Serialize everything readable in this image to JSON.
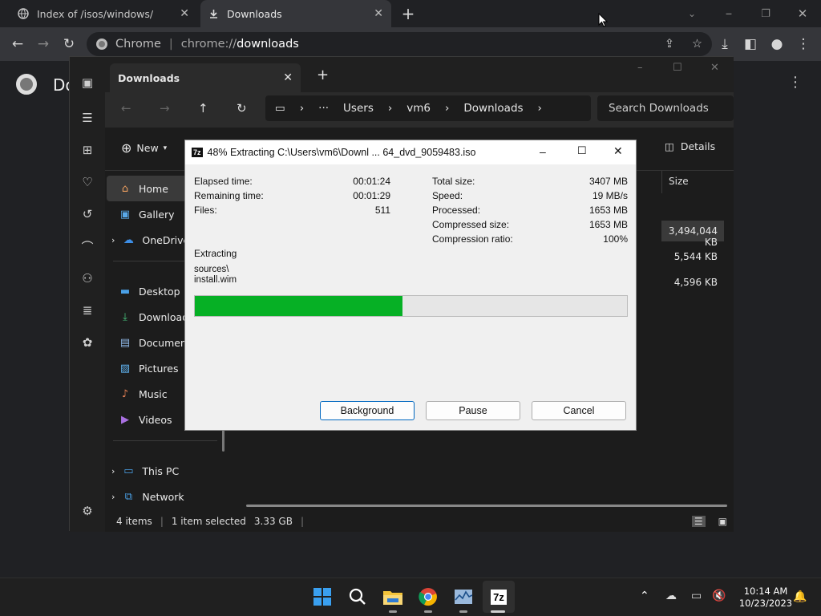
{
  "chrome": {
    "tabs": [
      {
        "title": "Index of /isos/windows/",
        "icon": "globe-icon"
      },
      {
        "title": "Downloads",
        "icon": "download-icon"
      }
    ],
    "omnibox": {
      "scheme_label": "Chrome",
      "url_prefix": "chrome://",
      "url_host": "downloads"
    },
    "page_title_partial": "Do"
  },
  "explorer": {
    "tab_title": "Downloads",
    "breadcrumb": [
      "Users",
      "vm6",
      "Downloads"
    ],
    "search_placeholder": "Search Downloads",
    "new_label": "New",
    "details_label": "Details",
    "column_size": "Size",
    "nav_items": [
      {
        "label": "Home",
        "icon": "home-icon"
      },
      {
        "label": "Gallery",
        "icon": "gallery-icon"
      },
      {
        "label": "OneDrive",
        "icon": "cloud-icon"
      },
      {
        "label": "Desktop",
        "icon": "desktop-icon"
      },
      {
        "label": "Downloads",
        "icon": "download-icon"
      },
      {
        "label": "Documents",
        "icon": "document-icon"
      },
      {
        "label": "Pictures",
        "icon": "pictures-icon"
      },
      {
        "label": "Music",
        "icon": "music-icon"
      },
      {
        "label": "Videos",
        "icon": "videos-icon"
      },
      {
        "label": "This PC",
        "icon": "pc-icon"
      },
      {
        "label": "Network",
        "icon": "network-icon"
      }
    ],
    "file_sizes": [
      "3,494,044 KB",
      "5,544 KB",
      "4,596 KB"
    ],
    "status": {
      "count": "4 items",
      "selected": "1 item selected",
      "size": "3.33 GB"
    }
  },
  "sevenzip": {
    "title": "48% Extracting C:\\Users\\vm6\\Downl ... 64_dvd_9059483.iso",
    "progress_fraction": 0.48,
    "left_stats": [
      {
        "label": "Elapsed time:",
        "value": "00:01:24"
      },
      {
        "label": "Remaining time:",
        "value": "00:01:29"
      },
      {
        "label": "Files:",
        "value": "511"
      }
    ],
    "right_stats": [
      {
        "label": "Total size:",
        "value": "3407 MB"
      },
      {
        "label": "Speed:",
        "value": "19 MB/s"
      },
      {
        "label": "Processed:",
        "value": "1653 MB"
      },
      {
        "label": "Compressed size:",
        "value": "1653 MB"
      },
      {
        "label": "Compression ratio:",
        "value": "100%"
      }
    ],
    "operation": "Extracting",
    "path_line1": "sources\\",
    "path_line2": "install.wim",
    "buttons": {
      "background": "Background",
      "pause": "Pause",
      "cancel": "Cancel"
    },
    "progress_color": "#06b025"
  },
  "taskbar": {
    "time": "10:14 AM",
    "date": "10/23/2023",
    "apps": [
      "windows-start-icon",
      "search-icon",
      "file-explorer-icon",
      "chrome-icon",
      "task-manager-icon",
      "7zip-icon"
    ]
  }
}
